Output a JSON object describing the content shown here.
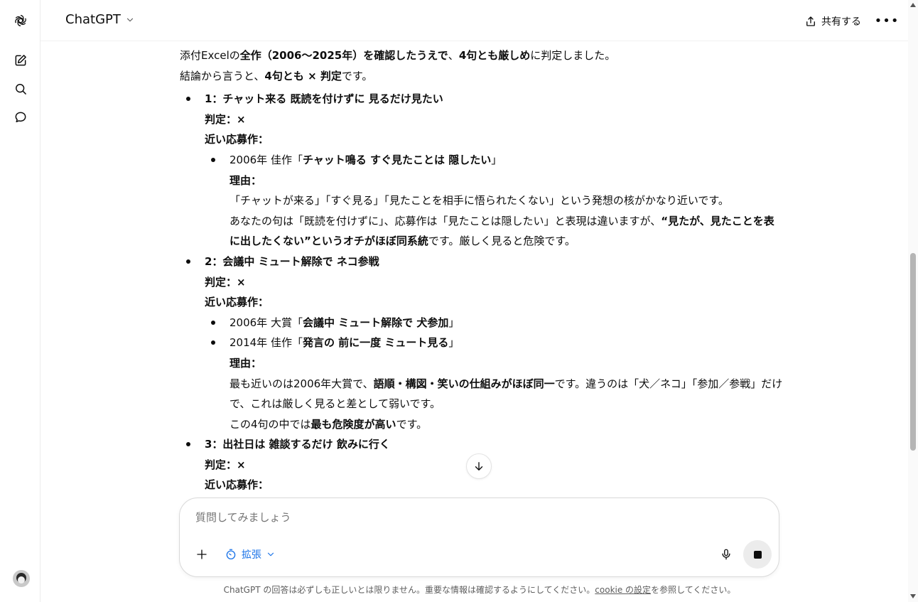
{
  "header": {
    "model_label": "ChatGPT",
    "share_label": "共有する",
    "more_label": "•••"
  },
  "message": {
    "intro1": [
      {
        "t": "添付Excelの",
        "b": false
      },
      {
        "t": "全作（2006〜2025年）を確認したうえで",
        "b": true
      },
      {
        "t": "、",
        "b": false
      },
      {
        "t": "4句とも厳しめ",
        "b": true
      },
      {
        "t": "に判定しました。",
        "b": false
      }
    ],
    "intro2": [
      {
        "t": "結論から言うと、",
        "b": false
      },
      {
        "t": "4句とも × 判定",
        "b": true
      },
      {
        "t": "です。",
        "b": false
      }
    ],
    "items": [
      {
        "title": "1：チャット来る 既読を付けずに 見るだけ見たい",
        "verdict": "判定：×",
        "near_label": "近い応募作：",
        "works": [
          {
            "segments": [
              {
                "t": "2006年 佳作「",
                "b": false
              },
              {
                "t": "チャット鳴る すぐ見たことは 隠したい",
                "b": true
              },
              {
                "t": "」",
                "b": false
              }
            ],
            "reason_label": "理由：",
            "reason_lines": [
              [
                {
                  "t": "「チャットが来る」「すぐ見る」「見たことを相手に悟られたくない」という発想の核がかなり近いです。",
                  "b": false
                }
              ],
              [
                {
                  "t": "あなたの句は「既読を付けずに」、応募作は「見たことは隠したい」と表現は違いますが、",
                  "b": false
                },
                {
                  "t": "“見たが、見たことを表に出したくない”というオチがほぼ同系統",
                  "b": true
                },
                {
                  "t": "です。厳しく見ると危険です。",
                  "b": false
                }
              ]
            ]
          }
        ]
      },
      {
        "title": "2：会議中 ミュート解除で ネコ参戦",
        "verdict": "判定：×",
        "near_label": "近い応募作：",
        "works": [
          {
            "segments": [
              {
                "t": "2006年 大賞「",
                "b": false
              },
              {
                "t": "会議中 ミュート解除で 犬参加",
                "b": true
              },
              {
                "t": "」",
                "b": false
              }
            ]
          },
          {
            "segments": [
              {
                "t": "2014年 佳作「",
                "b": false
              },
              {
                "t": "発言の 前に一度 ミュート見る",
                "b": true
              },
              {
                "t": "」",
                "b": false
              }
            ],
            "reason_label": "理由：",
            "reason_lines": [
              [
                {
                  "t": "最も近いのは2006年大賞で、",
                  "b": false
                },
                {
                  "t": "語順・構図・笑いの仕組みがほぼ同一",
                  "b": true
                },
                {
                  "t": "です。違うのは「犬／ネコ」「参加／参戦」だけで、これは厳しく見ると差として弱いです。",
                  "b": false
                }
              ],
              [
                {
                  "t": "この4句の中では",
                  "b": false
                },
                {
                  "t": "最も危険度が高い",
                  "b": true
                },
                {
                  "t": "です。",
                  "b": false
                }
              ]
            ]
          }
        ]
      },
      {
        "title": "3：出社日は 雑談するだけ 飲みに行く",
        "verdict": "判定：×",
        "near_label": "近い応募作：",
        "works": []
      }
    ]
  },
  "composer": {
    "placeholder": "質問してみましょう",
    "extension_label": "拡張"
  },
  "footer": {
    "disclaimer_pre": "ChatGPT の回答は必ずしも正しいとは限りません。重要な情報は確認するようにしてください。",
    "disclaimer_link": "cookie の設定",
    "disclaimer_post": "を参照してください。"
  },
  "icons": {
    "logo": "openai-logo-icon",
    "new_chat": "new-chat-icon",
    "search": "search-icon",
    "chats": "chat-bubble-icon",
    "share": "share-icon",
    "scroll_down": "arrow-down-icon",
    "plus": "plus-icon",
    "extension": "timer-icon",
    "mic": "microphone-icon",
    "stop": "stop-icon"
  },
  "colors": {
    "accent_blue": "#1a73e8",
    "text": "#0d0d0d",
    "muted": "#5d5d5d"
  }
}
